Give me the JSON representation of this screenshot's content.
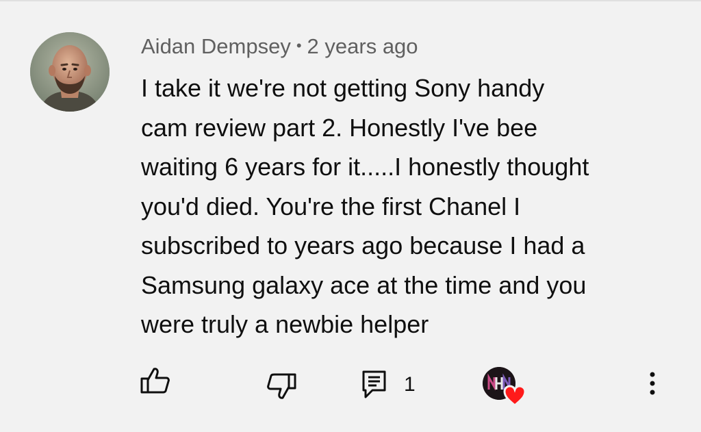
{
  "comment": {
    "author": "Aidan Dempsey",
    "separator": "•",
    "timestamp": "2 years ago",
    "lines": [
      "I take it we're not getting Sony handy",
      "cam review part 2. Honestly I've bee",
      "waiting 6 years for it.....I honestly thought",
      "you'd died. You're the first Chanel I",
      "subscribed to years ago because I had a",
      "Samsung galaxy ace at the time and you",
      "were truly a newbie helper"
    ]
  },
  "actions": {
    "like_icon": "thumb-up-icon",
    "dislike_icon": "thumb-down-icon",
    "reply_icon": "comment-reply-icon",
    "reply_count": "1",
    "creator_heart_icon": "creator-heart-icon",
    "more_icon": "more-vertical-icon"
  },
  "colors": {
    "background": "#f2f2f2",
    "text": "#0f0f0f",
    "meta_text": "#606060",
    "heart": "#ff1a1a"
  }
}
